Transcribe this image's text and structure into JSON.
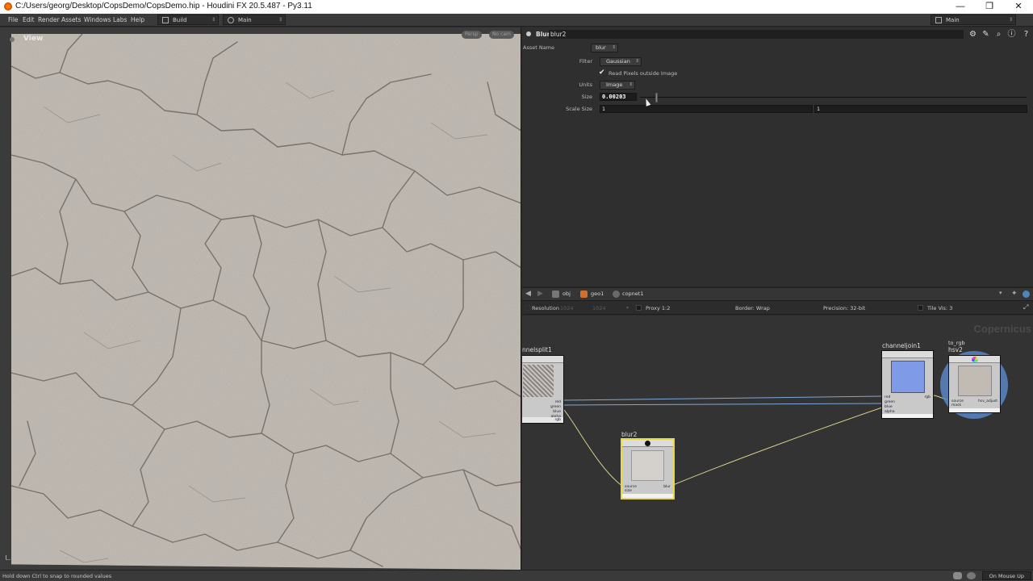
{
  "window": {
    "title": "C:/Users/georg/Desktop/CopsDemo/CopsDemo.hip - Houdini FX 20.5.487 - Py3.11",
    "minimize": "—",
    "maximize": "❐",
    "close": "✕"
  },
  "menu": {
    "items": [
      "File",
      "Edit",
      "Render",
      "Assets",
      "Windows",
      "Labs",
      "Help"
    ],
    "desktop": "Build",
    "context": "Main",
    "right_desktop": "Main"
  },
  "viewport": {
    "label": "View",
    "persp": "Persp",
    "nocam": "No cam"
  },
  "params": {
    "node_type": "Blur",
    "node_name": "blur2",
    "asset_name_label": "Asset Name",
    "asset_name_value": "blur",
    "filter_label": "Filter",
    "filter_value": "Gaussian",
    "read_pixels_label": "Read Pixels outside Image",
    "read_pixels_checked": true,
    "units_label": "Units",
    "units_value": "Image",
    "size_label": "Size",
    "size_value": "0.00203",
    "size_slider_fraction": 0.04,
    "scale_size_label": "Scale Size",
    "scale_size_x": "1",
    "scale_size_y": "1"
  },
  "network_nav": {
    "path": [
      "obj",
      "geo1",
      "copnet1"
    ]
  },
  "network_options": {
    "resolution_label": "Resolution",
    "resolution_w": "1024",
    "resolution_h": "1024",
    "proxy": "Proxy 1:2",
    "border": "Border: Wrap",
    "precision": "Precision: 32-bit",
    "tile_vis": "Tile Vis: 3"
  },
  "network": {
    "context_label": "Copernicus",
    "nodes": {
      "channelsplit": {
        "label": "nnelsplit1",
        "ports_out": [
          "red",
          "green",
          "blue",
          "alpha"
        ],
        "port_in": "rgb"
      },
      "blur": {
        "label": "blur2",
        "ports_in": [
          "source",
          "size"
        ],
        "port_out": "blur"
      },
      "channeljoin": {
        "label": "channeljoin1",
        "ports_in": [
          "red",
          "green",
          "blue",
          "alpha"
        ],
        "port_out": "rgb"
      },
      "hsv": {
        "label_top": "to_rgb",
        "label": "hsv2",
        "ports_in": [
          "source",
          "mask"
        ],
        "port_out": "hsv_adjust"
      }
    }
  },
  "status": {
    "message": "Hold down Ctrl to snap to rounded values",
    "update_mode": "On Mouse Up"
  },
  "colors": {
    "selected_node": "#e7d84a",
    "wire_blue": "#7fa8d6",
    "wire_yellow": "#d6d08a"
  }
}
